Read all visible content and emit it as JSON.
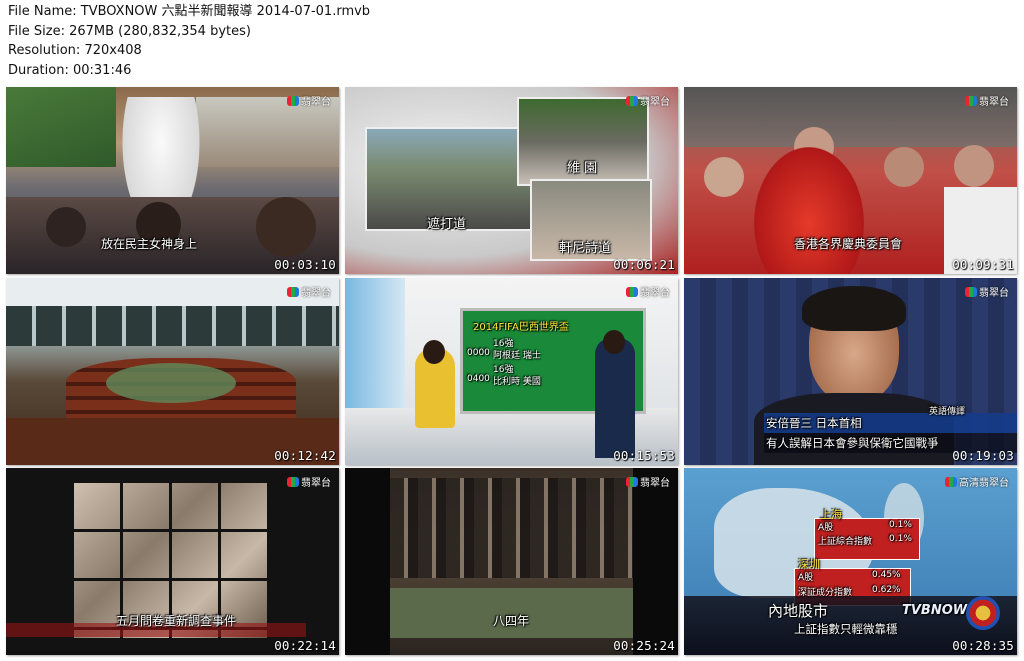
{
  "file_info": {
    "name_line": "File Name: TVBOXNOW 六點半新聞報導 2014-07-01.rmvb",
    "size_line": "File Size: 267MB (280,832,354 bytes)",
    "resolution_line": "Resolution: 720x408",
    "duration_line": "Duration: 00:31:46"
  },
  "channel_logo": "翡翠台",
  "channel_logo_hd": "高清翡翠台",
  "thumbnails": [
    {
      "timestamp": "00:03:10",
      "subtitle": "放在民主女神身上"
    },
    {
      "timestamp": "00:06:21",
      "labels": [
        "維 園",
        "遮打道",
        "軒尼詩道"
      ]
    },
    {
      "timestamp": "00:09:31",
      "subtitle": "香港各界慶典委員會"
    },
    {
      "timestamp": "00:12:42"
    },
    {
      "timestamp": "00:15:53",
      "screen_title": "2014FIFA巴西世界盃",
      "screen_rows": [
        "16強",
        "阿根廷 瑞士",
        "16強",
        "比利時 美國"
      ],
      "screen_times": [
        "0000",
        "0400"
      ]
    },
    {
      "timestamp": "00:19:03",
      "name_bar": "安倍晉三 日本首相",
      "tag": "英語傳譯",
      "subtitle": "有人誤解日本會參與保衛它國戰爭"
    },
    {
      "timestamp": "00:22:14",
      "subtitle": "五月問卷重新調查事件"
    },
    {
      "timestamp": "00:25:24",
      "subtitle": "八四年"
    },
    {
      "timestamp": "00:28:35",
      "market": {
        "city1": "上海",
        "rows1": [
          {
            "label": "A股",
            "value": "0.1%"
          },
          {
            "label": "上証綜合指數",
            "value": "0.1%"
          }
        ],
        "city2": "深圳",
        "rows2": [
          {
            "label": "A股",
            "value": "0.45%"
          },
          {
            "label": "深証成分指數",
            "value": "0.62%"
          }
        ],
        "title": "內地股市",
        "subtitle": "上証指數只輕微靠穩",
        "watermark": "TVBNOW"
      }
    }
  ]
}
